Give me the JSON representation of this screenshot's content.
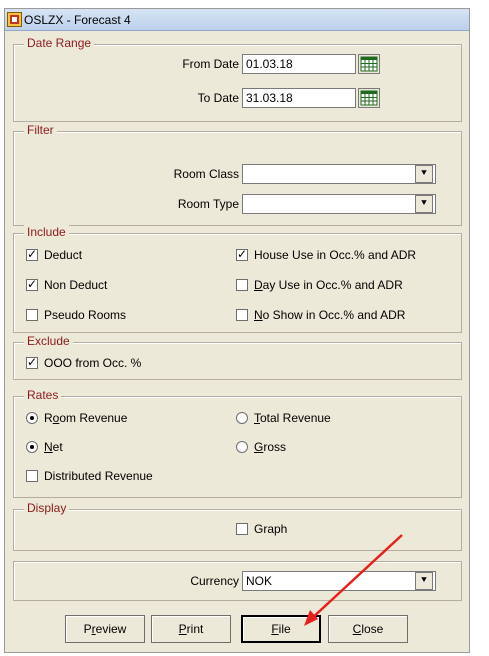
{
  "window": {
    "title": "OSLZX - Forecast 4"
  },
  "date_range": {
    "group_label": "Date Range",
    "from_label": "From Date",
    "from_value": "01.03.18",
    "to_label": "To Date",
    "to_value": "31.03.18"
  },
  "filter": {
    "group_label": "Filter",
    "room_class_label": "Room Class",
    "room_class_value": "",
    "room_type_label": "Room  Type",
    "room_type_value": ""
  },
  "include": {
    "group_label": "Include",
    "items": [
      {
        "label": "Deduct",
        "checked": true
      },
      {
        "label": "Non Deduct",
        "checked": true
      },
      {
        "label": "Pseudo Rooms",
        "checked": false
      },
      {
        "label": "House Use in Occ.% and ADR",
        "checked": true
      },
      {
        "label_first": "D",
        "label_rest": "ay Use in Occ.% and ADR",
        "checked": false
      },
      {
        "label_first": "N",
        "label_rest": "o Show in Occ.% and ADR",
        "checked": false
      }
    ]
  },
  "exclude": {
    "group_label": "Exclude",
    "ooo_label": "OOO from Occ. %",
    "ooo_checked": true
  },
  "rates": {
    "group_label": "Rates",
    "room_revenue_pre": "R",
    "room_revenue_u": "o",
    "room_revenue_post": "om Revenue",
    "total_revenue_u": "T",
    "total_revenue_post": "otal Revenue",
    "net_u": "N",
    "net_post": "et",
    "gross_u": "G",
    "gross_post": "ross",
    "distributed_label": "Distributed Revenue"
  },
  "display": {
    "group_label": "Display",
    "graph_label": "Graph",
    "graph_checked": false
  },
  "currency": {
    "label": "Currency",
    "value": "NOK"
  },
  "buttons": {
    "preview_pre": "P",
    "preview_u": "r",
    "preview_post": "eview",
    "print_u": "P",
    "print_post": "rint",
    "file_u": "F",
    "file_post": "ile",
    "close_u": "C",
    "close_post": "lose"
  },
  "colors": {
    "group_label": "#8b1a1a",
    "annotation_arrow": "#e8201c"
  }
}
